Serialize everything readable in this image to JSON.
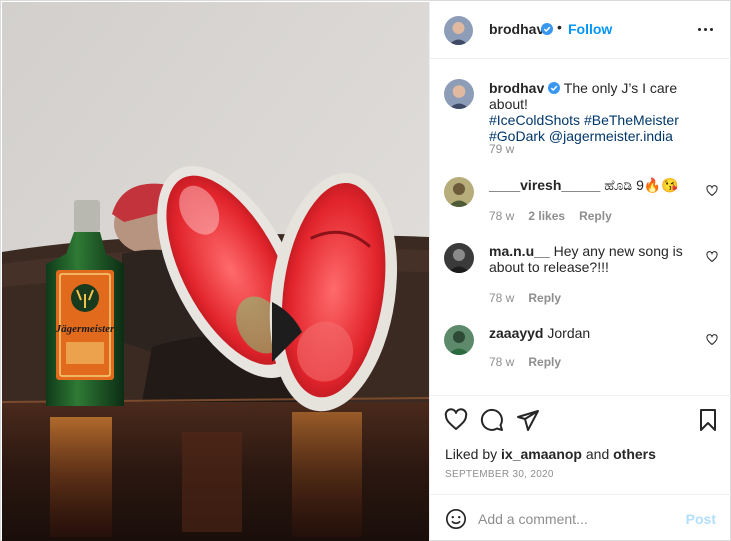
{
  "post": {
    "username": "brodhav",
    "follow_label": "Follow",
    "separator": "•",
    "image": {
      "bottle_label": "Jägermeister"
    }
  },
  "caption": {
    "username": "brodhav",
    "text": "The only J’s I care about!",
    "hashtags": [
      "#IceColdShots",
      "#BeTheMeister",
      "#GoDark",
      "@jagermeister.india"
    ],
    "time": "79 w"
  },
  "comments": [
    {
      "username": "____viresh_____",
      "text": "ಹೊಡಿ 9🔥😘",
      "time": "78 w",
      "likes": "2 likes",
      "reply": "Reply"
    },
    {
      "username": "ma.n.u__",
      "text": "Hey any new song is about to release?!!!",
      "time": "78 w",
      "reply": "Reply"
    },
    {
      "username": "zaaayyd",
      "text": "Jordan",
      "time": "78 w",
      "reply": "Reply"
    }
  ],
  "liked_by": {
    "prefix": "Liked by ",
    "user": "ix_amaanop",
    "middle": " and ",
    "others": "others"
  },
  "date": "SEPTEMBER 30, 2020",
  "add_comment": {
    "placeholder": "Add a comment...",
    "post_label": "Post"
  },
  "icons": {
    "verified": "verified-badge-icon",
    "more": "more-options-icon",
    "like": "heart-icon",
    "comment": "comment-icon",
    "share": "share-icon",
    "save": "bookmark-icon",
    "emoji": "emoji-icon"
  },
  "colors": {
    "accent": "#0095f6",
    "post_disabled": "#b2dffc",
    "tag": "#00376b",
    "muted": "#8e8e8e"
  }
}
